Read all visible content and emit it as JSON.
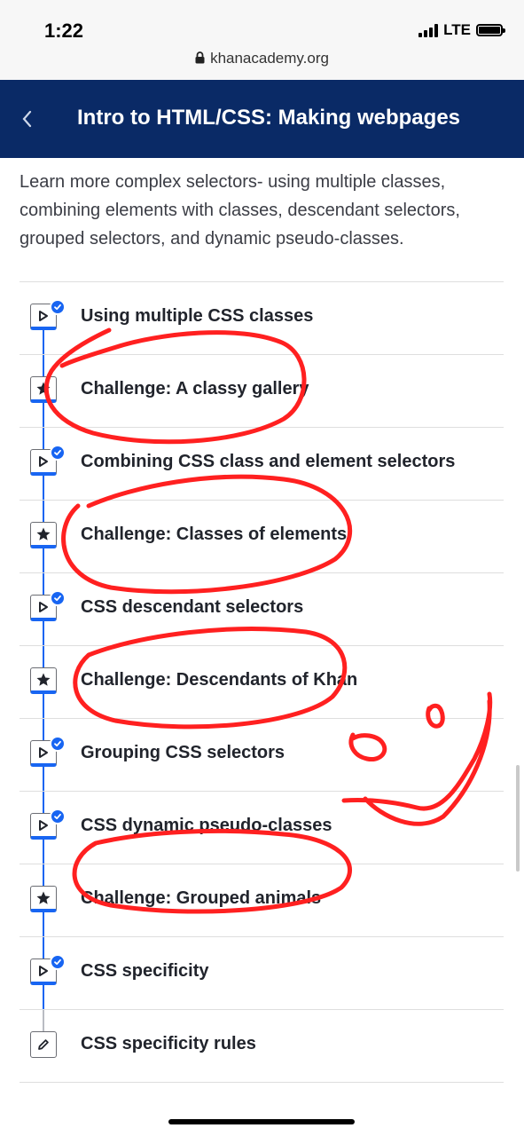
{
  "status_bar": {
    "time": "1:22",
    "network": "LTE",
    "url": "khanacademy.org"
  },
  "header": {
    "title": "Intro to HTML/CSS: Making webpages",
    "background": "#0a2a66"
  },
  "description": "Learn more complex selectors- using multiple classes, combining elements with classes, descendant selectors, grouped selectors, and dynamic pseudo-classes.",
  "lessons": [
    {
      "label": "Using multiple CSS classes",
      "type": "video",
      "completed": true
    },
    {
      "label": "Challenge: A classy gallery",
      "type": "challenge",
      "completed": false
    },
    {
      "label": "Combining CSS class and element selectors",
      "type": "video",
      "completed": true
    },
    {
      "label": "Challenge: Classes of elements",
      "type": "challenge",
      "completed": false
    },
    {
      "label": "CSS descendant selectors",
      "type": "video",
      "completed": true
    },
    {
      "label": "Challenge: Descendants of Khan",
      "type": "challenge",
      "completed": false
    },
    {
      "label": "Grouping CSS selectors",
      "type": "video",
      "completed": true
    },
    {
      "label": "CSS dynamic pseudo-classes",
      "type": "video",
      "completed": true
    },
    {
      "label": "Challenge: Grouped animals",
      "type": "challenge",
      "completed": false
    },
    {
      "label": "CSS specificity",
      "type": "video",
      "completed": true
    },
    {
      "label": "CSS specificity rules",
      "type": "article",
      "completed": false
    }
  ],
  "colors": {
    "accent": "#1865f2",
    "annotation": "#ff2020"
  },
  "icons": {
    "video": "play-icon",
    "challenge": "star-icon",
    "article": "pencil-icon",
    "completed": "checkmark-icon"
  }
}
